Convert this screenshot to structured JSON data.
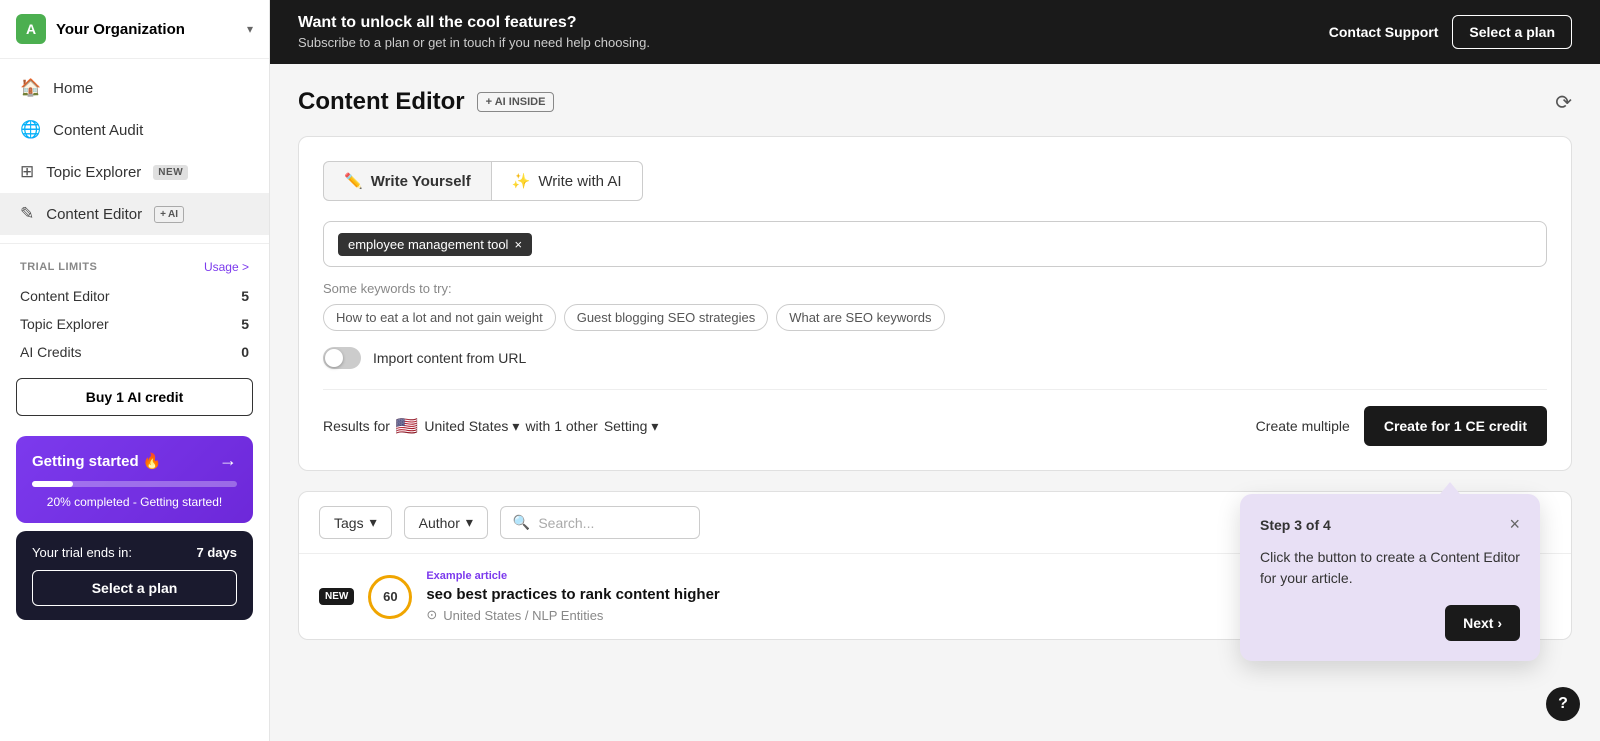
{
  "sidebar": {
    "org_name": "Your Organization",
    "org_initial": "A",
    "nav_items": [
      {
        "id": "home",
        "label": "Home",
        "icon": "🏠",
        "badge": null
      },
      {
        "id": "content-audit",
        "label": "Content Audit",
        "icon": "🌐",
        "badge": null
      },
      {
        "id": "topic-explorer",
        "label": "Topic Explorer",
        "icon": "⊞",
        "badge": "NEW"
      },
      {
        "id": "content-editor",
        "label": "Content Editor",
        "icon": "✎",
        "badge": "AI",
        "active": true
      }
    ],
    "trial_limits": {
      "label": "TRIAL LIMITS",
      "usage_label": "Usage >",
      "items": [
        {
          "name": "Content Editor",
          "count": "5"
        },
        {
          "name": "Topic Explorer",
          "count": "5"
        },
        {
          "name": "AI Credits",
          "count": "0"
        }
      ]
    },
    "buy_ai_label": "Buy 1 AI credit",
    "getting_started": {
      "title": "Getting started 🔥",
      "arrow": "→",
      "progress": 20,
      "label": "20% completed - Getting started!"
    },
    "trial": {
      "text": "Your trial ends in:",
      "days": "7 days",
      "select_plan": "Select a plan"
    }
  },
  "banner": {
    "title": "Want to unlock all the cool features?",
    "subtitle": "Subscribe to a plan or get in touch if you need help choosing.",
    "contact_label": "Contact Support",
    "select_plan_label": "Select a plan"
  },
  "page": {
    "title": "Content Editor",
    "ai_badge": "+ AI INSIDE",
    "refresh_icon": "⟳"
  },
  "editor": {
    "tab_write_yourself": "Write Yourself",
    "tab_write_ai": "Write with AI",
    "keyword_chip": "employee management tool",
    "suggestions_label": "Some keywords to try:",
    "suggestions": [
      "How to eat a lot and not gain weight",
      "Guest blogging SEO strategies",
      "What are SEO keywords"
    ],
    "import_label": "Import content from URL",
    "results_for": "Results for",
    "flag": "🇺🇸",
    "country": "United States",
    "setting_prefix": "with 1 other",
    "setting_label": "Setting",
    "create_multiple": "Create multiple",
    "create_ce_btn": "Create for 1 CE credit"
  },
  "filters": {
    "tags_label": "Tags",
    "author_label": "Author",
    "search_placeholder": "Search..."
  },
  "article": {
    "badge": "NEW",
    "score": "60",
    "title": "seo best practices to rank content higher",
    "meta": "United States / NLP Entities",
    "example_label": "Example article"
  },
  "tooltip": {
    "step": "Step 3 of 4",
    "close": "×",
    "text": "Click the button to create a Content Editor for your article.",
    "next_label": "Next ›"
  },
  "help": {
    "icon": "?"
  }
}
